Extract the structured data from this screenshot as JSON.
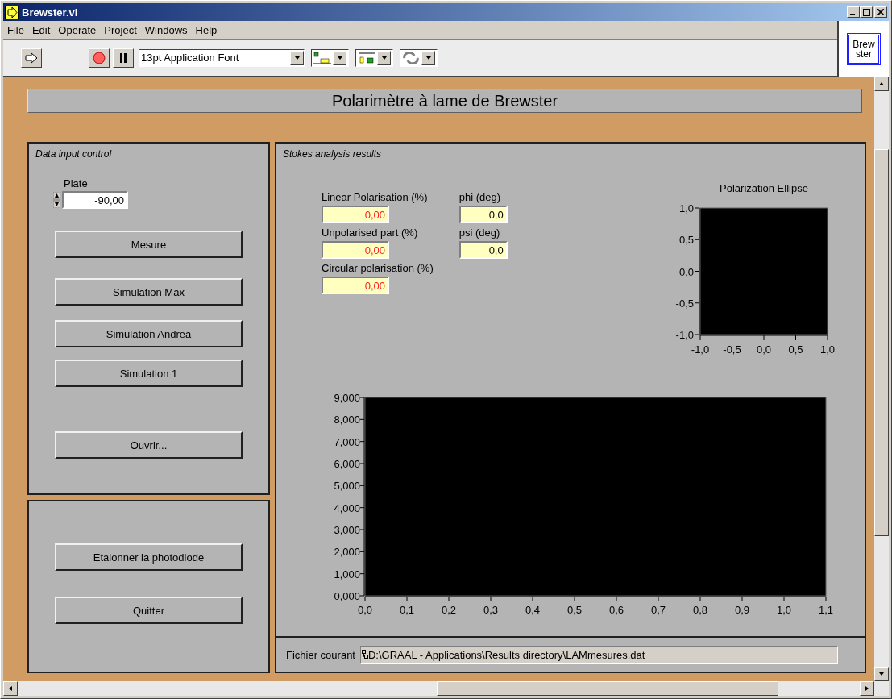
{
  "window": {
    "title": "Brewster.vi"
  },
  "menu": [
    "File",
    "Edit",
    "Operate",
    "Project",
    "Windows",
    "Help"
  ],
  "toolbar": {
    "font_menu": "13pt Application Font"
  },
  "vi_icon": {
    "lines": [
      "Brew",
      "ster"
    ]
  },
  "panel_title": "Polarimètre à lame de Brewster",
  "input_group": {
    "legend": "Data input control",
    "plate": {
      "label": "Plate",
      "value": "-90,00"
    },
    "buttons": [
      "Mesure",
      "Simulation Max",
      "Simulation Andrea",
      "Simulation 1",
      "Ouvrir..."
    ]
  },
  "action_group": {
    "buttons": [
      "Etalonner la photodiode",
      "Quitter"
    ]
  },
  "results": {
    "legend": "Stokes analysis results",
    "percent_indicators": [
      {
        "label": "Linear Polarisation (%)",
        "value": "0,00"
      },
      {
        "label": "Unpolarised part (%)",
        "value": "0,00"
      },
      {
        "label": "Circular polarisation (%)",
        "value": "0,00"
      }
    ],
    "angle_indicators": [
      {
        "label": "phi (deg)",
        "value": "0,0"
      },
      {
        "label": "psi (deg)",
        "value": "0,0"
      }
    ],
    "ellipse_chart": {
      "chart_data": {
        "type": "line",
        "title": "Polarization Ellipse",
        "xlim": [
          -1,
          1
        ],
        "ylim": [
          -1,
          1
        ],
        "xticks": [
          {
            "value": -1,
            "label": "-1,0"
          },
          {
            "value": -0.5,
            "label": "-0,5"
          },
          {
            "value": 0,
            "label": "0,0"
          },
          {
            "value": 0.5,
            "label": "0,5"
          },
          {
            "value": 1,
            "label": "1,0"
          }
        ],
        "yticks": [
          {
            "value": -1,
            "label": "-1,0"
          },
          {
            "value": -0.5,
            "label": "-0,5"
          },
          {
            "value": 0,
            "label": "0,0"
          },
          {
            "value": 0.5,
            "label": "0,5"
          },
          {
            "value": 1,
            "label": "1,0"
          }
        ]
      }
    },
    "main_chart": {
      "chart_data": {
        "type": "line",
        "xlim": [
          0,
          1.1
        ],
        "ylim": [
          0,
          9
        ],
        "xticks": [
          {
            "value": 0,
            "label": "0,0"
          },
          {
            "value": 0.1,
            "label": "0,1"
          },
          {
            "value": 0.2,
            "label": "0,2"
          },
          {
            "value": 0.3,
            "label": "0,3"
          },
          {
            "value": 0.4,
            "label": "0,4"
          },
          {
            "value": 0.5,
            "label": "0,5"
          },
          {
            "value": 0.6,
            "label": "0,6"
          },
          {
            "value": 0.7,
            "label": "0,7"
          },
          {
            "value": 0.8,
            "label": "0,8"
          },
          {
            "value": 0.9,
            "label": "0,9"
          },
          {
            "value": 1,
            "label": "1,0"
          },
          {
            "value": 1.1,
            "label": "1,1"
          }
        ],
        "yticks": [
          {
            "value": 0,
            "label": "0,000"
          },
          {
            "value": 1,
            "label": "1,000"
          },
          {
            "value": 2,
            "label": "2,000"
          },
          {
            "value": 3,
            "label": "3,000"
          },
          {
            "value": 4,
            "label": "4,000"
          },
          {
            "value": 5,
            "label": "5,000"
          },
          {
            "value": 6,
            "label": "6,000"
          },
          {
            "value": 7,
            "label": "7,000"
          },
          {
            "value": 8,
            "label": "8,000"
          },
          {
            "value": 9,
            "label": "9,000"
          }
        ]
      }
    },
    "file": {
      "label": "Fichier courant",
      "path": "D:\\GRAAL - Applications\\Results directory\\LAMmesures.dat"
    }
  }
}
